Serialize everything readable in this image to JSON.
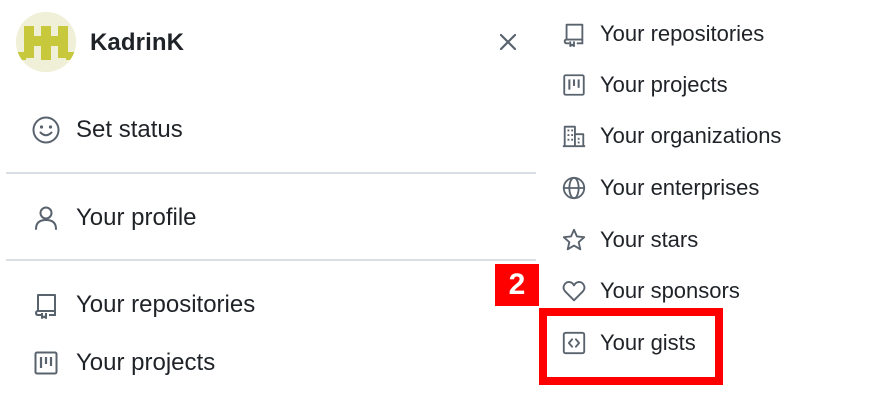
{
  "user": {
    "username": "KadrinK"
  },
  "left_menu": {
    "set_status": "Set status",
    "your_profile": "Your profile",
    "your_repositories": "Your repositories",
    "your_projects": "Your projects"
  },
  "right_menu": {
    "items": [
      {
        "label": "Your repositories",
        "icon": "repo-icon"
      },
      {
        "label": "Your projects",
        "icon": "project-icon"
      },
      {
        "label": "Your organizations",
        "icon": "organization-icon"
      },
      {
        "label": "Your enterprises",
        "icon": "globe-icon"
      },
      {
        "label": "Your stars",
        "icon": "star-icon"
      },
      {
        "label": "Your sponsors",
        "icon": "heart-icon"
      },
      {
        "label": "Your gists",
        "icon": "code-square-icon"
      }
    ]
  },
  "annotation": {
    "step_number": "2",
    "highlight_color": "#ff0000"
  },
  "colors": {
    "text": "#1f2328",
    "icon": "#59636e",
    "divider": "#d8dee4",
    "avatar_fg": "#c8c83c",
    "avatar_bg": "#f0efd7"
  }
}
